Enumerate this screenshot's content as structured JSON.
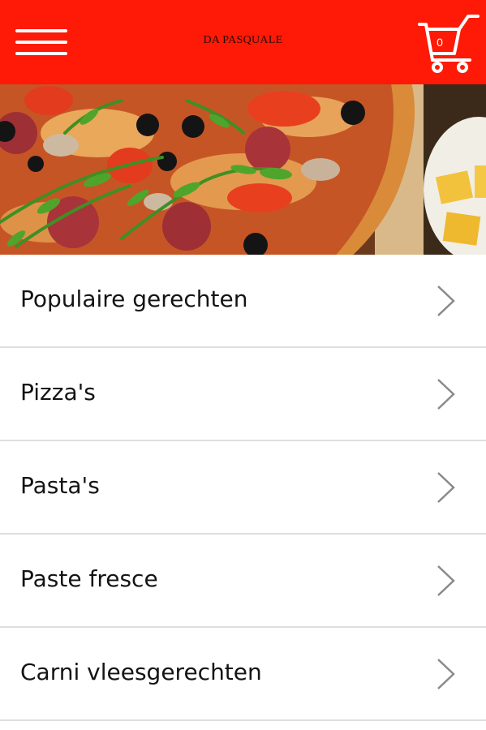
{
  "header": {
    "title": "DA PASQUALE",
    "cart_count": "0",
    "menu_icon": "hamburger-menu-icon",
    "cart_icon": "shopping-cart-icon",
    "background_color": "#fe1a06"
  },
  "hero": {
    "image": "pizza-photo"
  },
  "categories": [
    {
      "label": "Populaire gerechten"
    },
    {
      "label": "Pizza's"
    },
    {
      "label": "Pasta's"
    },
    {
      "label": "Paste fresce"
    },
    {
      "label": "Carni vleesgerechten"
    }
  ],
  "colors": {
    "accent": "#fe1a06",
    "divider": "#dedede",
    "text": "#141414",
    "chevron": "#8a8a8a"
  }
}
